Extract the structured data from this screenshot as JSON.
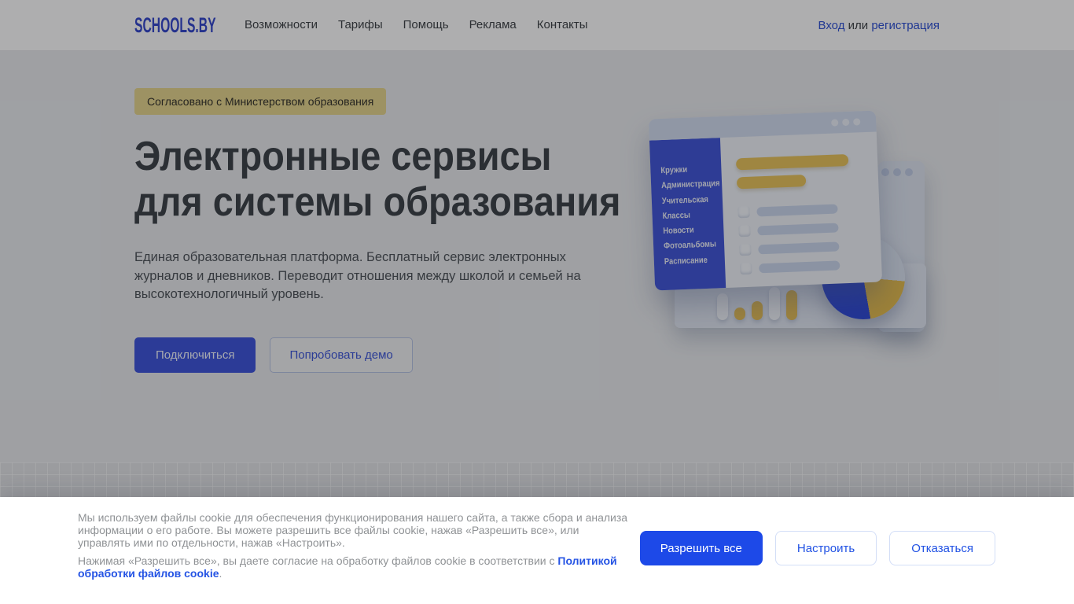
{
  "nav": {
    "logo": "SCHOOLS.BY",
    "links": [
      "Возможности",
      "Тарифы",
      "Помощь",
      "Реклама",
      "Контакты"
    ],
    "auth": {
      "login": "Вход",
      "separator": " или ",
      "register": "регистрация"
    }
  },
  "hero": {
    "badge": "Согласовано с Министерством образования",
    "title_line1": "Электронные сервисы",
    "title_line2": "для системы образования",
    "description": "Единая образовательная платформа. Бесплатный сервис электронных журналов и дневников. Переводит отношения между школой и семьей на высокотехнологичный уровень.",
    "primary_button": "Подключиться",
    "secondary_button": "Попробовать демо"
  },
  "illustration": {
    "sidebar_items": [
      "Кружки",
      "Администрация",
      "Учительская",
      "Классы",
      "Новости",
      "Фотоальбомы",
      "Расписание"
    ]
  },
  "cookie_banner": {
    "paragraph1": "Мы используем файлы cookie для обеспечения функционирования нашего сайта, а также сбора и анализа информации о его работе. Вы можете разрешить все файлы cookie, нажав «Разрешить все», или управлять ими по отдельности, нажав «Настроить».",
    "paragraph2_prefix": "Нажимая «Разрешить все», вы даете согласие на обработку файлов cookie в соответствии с ",
    "policy_link": "Политикой обработки файлов cookie",
    "paragraph2_suffix": ".",
    "allow_button": "Разрешить все",
    "configure_button": "Настроить",
    "decline_button": "Отказаться"
  },
  "colors": {
    "brand_blue": "#2d50d4",
    "cookie_button_blue": "#1d49e8",
    "hero_button_blue": "#3e54dc",
    "sidebar_blue": "#4156d8",
    "accent_yellow": "#e5be55",
    "badge_yellow": "#e6d58e"
  }
}
